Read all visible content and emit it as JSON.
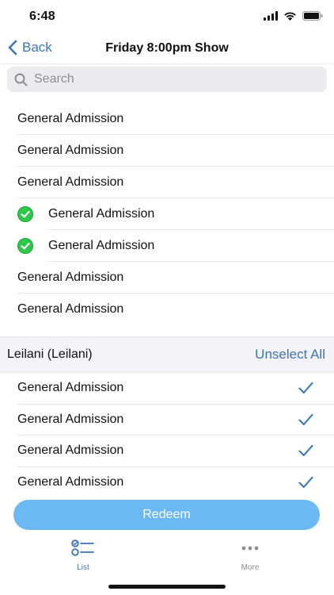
{
  "status_bar": {
    "time": "6:48"
  },
  "nav": {
    "back_label": "Back",
    "title": "Friday 8:00pm Show"
  },
  "search": {
    "placeholder": "Search"
  },
  "first_section": {
    "items": [
      {
        "label": "General Admission",
        "selected": false
      },
      {
        "label": "General Admission",
        "selected": false
      },
      {
        "label": "General Admission",
        "selected": false
      },
      {
        "label": "General Admission",
        "selected": true
      },
      {
        "label": "General Admission",
        "selected": true
      },
      {
        "label": "General Admission",
        "selected": false
      },
      {
        "label": "General Admission",
        "selected": false
      }
    ]
  },
  "second_section": {
    "name": "Leilani (Leilani)",
    "action_label": "Unselect All",
    "items": [
      {
        "label": "General Admission",
        "checked": true
      },
      {
        "label": "General Admission",
        "checked": true
      },
      {
        "label": "General Admission",
        "checked": true
      },
      {
        "label": "General Admission",
        "checked": true
      }
    ]
  },
  "redeem_label": "Redeem",
  "tabs": [
    {
      "label": "List",
      "active": true,
      "icon": "list-icon"
    },
    {
      "label": "More",
      "active": false,
      "icon": "more-icon"
    }
  ],
  "colors": {
    "accent": "#3b73b9",
    "button": "#6cb8f3",
    "selected_green": "#2fc94a"
  }
}
